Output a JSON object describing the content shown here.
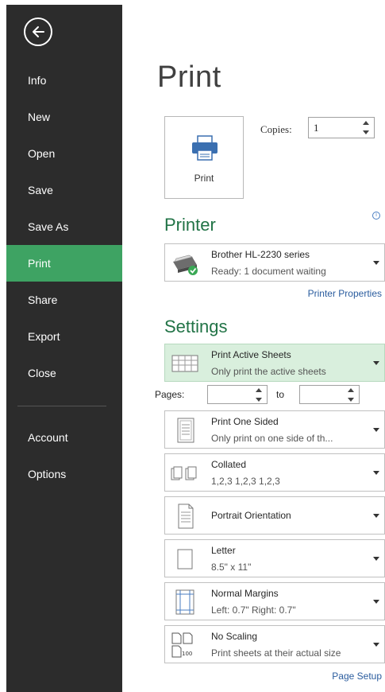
{
  "sidebar": {
    "items": [
      {
        "label": "Info"
      },
      {
        "label": "New"
      },
      {
        "label": "Open"
      },
      {
        "label": "Save"
      },
      {
        "label": "Save As"
      },
      {
        "label": "Print"
      },
      {
        "label": "Share"
      },
      {
        "label": "Export"
      },
      {
        "label": "Close"
      },
      {
        "label": "Account"
      },
      {
        "label": "Options"
      }
    ],
    "active": "Print"
  },
  "main": {
    "title": "Print",
    "print_button_label": "Print",
    "copies_label": "Copies:",
    "copies_value": "1"
  },
  "printer": {
    "section_title": "Printer",
    "name": "Brother HL-2230 series",
    "status": "Ready: 1 document waiting",
    "properties_link": "Printer Properties"
  },
  "settings": {
    "section_title": "Settings",
    "active_sheets": {
      "title": "Print Active Sheets",
      "subtitle": "Only print the active sheets"
    },
    "pages_label": "Pages:",
    "pages_from": "",
    "to_label": "to",
    "pages_to": "",
    "sided": {
      "title": "Print One Sided",
      "subtitle": "Only print on one side of th..."
    },
    "collated": {
      "title": "Collated",
      "subtitle": "1,2,3   1,2,3   1,2,3"
    },
    "orientation": {
      "title": "Portrait Orientation"
    },
    "paper": {
      "title": "Letter",
      "subtitle": "8.5\" x 11\""
    },
    "margins": {
      "title": "Normal Margins",
      "subtitle": "Left: 0.7\"   Right: 0.7\""
    },
    "scaling": {
      "title": "No Scaling",
      "subtitle": "Print sheets at their actual size",
      "icon_text": "100"
    },
    "page_setup_link": "Page Setup"
  },
  "colors": {
    "sidebar_bg": "#2c2c2c",
    "active_nav": "#3ea363",
    "accent_green": "#217346",
    "selected_row": "#d9efdd",
    "link_blue": "#2a5c9e"
  }
}
